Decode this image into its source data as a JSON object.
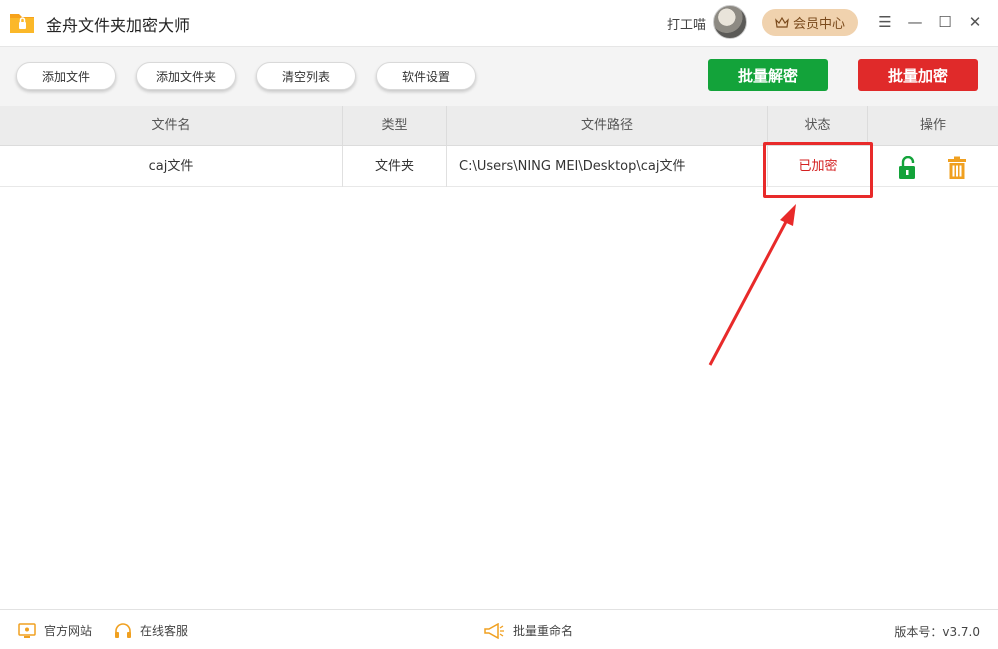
{
  "window": {
    "title": "金舟文件夹加密大师",
    "user_name": "打工喵",
    "vip_label": "会员中心"
  },
  "toolbar": {
    "buttons": [
      "添加文件",
      "添加文件夹",
      "清空列表",
      "软件设置"
    ],
    "batch_decrypt": "批量解密",
    "batch_encrypt": "批量加密"
  },
  "table": {
    "headers": [
      "文件名",
      "类型",
      "文件路径",
      "状态",
      "操作"
    ],
    "rows": [
      {
        "name": "caj文件",
        "type": "文件夹",
        "path": "C:\\Users\\NING MEI\\Desktop\\caj文件",
        "status": "已加密"
      }
    ]
  },
  "footer": {
    "website": "官方网站",
    "support": "在线客服",
    "batch_rename": "批量重命名",
    "version": "版本号：v3.7.0"
  },
  "colors": {
    "accent_green": "#13a33a",
    "accent_red": "#e02a2a",
    "status_red": "#d42121",
    "vip_gold": "#f0d2ae",
    "delete_orange": "#f0a020"
  },
  "icons": [
    "app-logo-icon",
    "avatar",
    "crown-icon",
    "menu-icon",
    "minimize-icon",
    "maximize-icon",
    "close-icon",
    "unlock-icon",
    "trash-icon",
    "monitor-icon",
    "headset-icon",
    "megaphone-icon"
  ]
}
